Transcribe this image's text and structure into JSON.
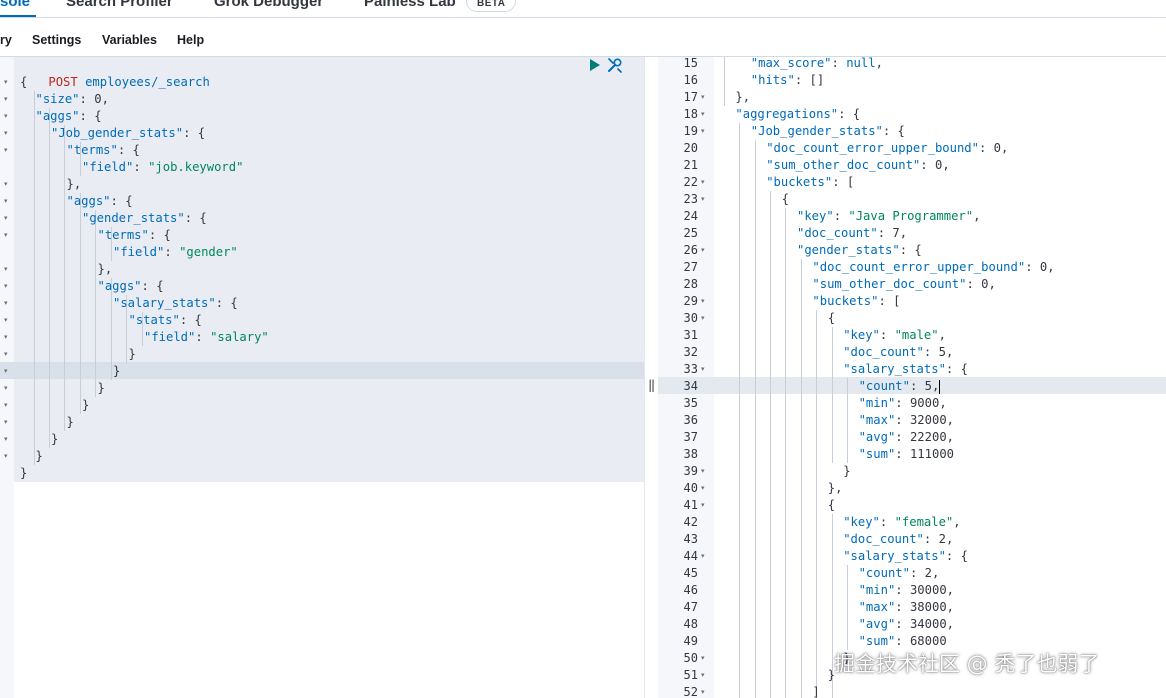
{
  "tabs": [
    {
      "label": "sole",
      "active": true
    },
    {
      "label": "Search Profiler",
      "active": false
    },
    {
      "label": "Grok Debugger",
      "active": false
    },
    {
      "label": "Painless Lab",
      "active": false
    }
  ],
  "beta_badge": "BETA",
  "menu": {
    "history": "ry",
    "settings": "Settings",
    "variables": "Variables",
    "help": "Help"
  },
  "request": {
    "method": "POST",
    "url": "employees/_search"
  },
  "response_lines": [
    {
      "num": "15",
      "fold": false
    },
    {
      "num": "16",
      "fold": false
    },
    {
      "num": "17",
      "fold": true
    },
    {
      "num": "18",
      "fold": true
    },
    {
      "num": "19",
      "fold": true
    },
    {
      "num": "20",
      "fold": false
    },
    {
      "num": "21",
      "fold": false
    },
    {
      "num": "22",
      "fold": true
    },
    {
      "num": "23",
      "fold": true
    },
    {
      "num": "24",
      "fold": false
    },
    {
      "num": "25",
      "fold": false
    },
    {
      "num": "26",
      "fold": true
    },
    {
      "num": "27",
      "fold": false
    },
    {
      "num": "28",
      "fold": false
    },
    {
      "num": "29",
      "fold": true
    },
    {
      "num": "30",
      "fold": true
    },
    {
      "num": "31",
      "fold": false
    },
    {
      "num": "32",
      "fold": false
    },
    {
      "num": "33",
      "fold": true
    },
    {
      "num": "34",
      "fold": false
    },
    {
      "num": "35",
      "fold": false
    },
    {
      "num": "36",
      "fold": false
    },
    {
      "num": "37",
      "fold": false
    },
    {
      "num": "38",
      "fold": false
    },
    {
      "num": "39",
      "fold": true
    },
    {
      "num": "40",
      "fold": true
    },
    {
      "num": "41",
      "fold": true
    },
    {
      "num": "42",
      "fold": false
    },
    {
      "num": "43",
      "fold": false
    },
    {
      "num": "44",
      "fold": true
    },
    {
      "num": "45",
      "fold": false
    },
    {
      "num": "46",
      "fold": false
    },
    {
      "num": "47",
      "fold": false
    },
    {
      "num": "48",
      "fold": false
    },
    {
      "num": "49",
      "fold": false
    },
    {
      "num": "50",
      "fold": true
    },
    {
      "num": "51",
      "fold": true
    },
    {
      "num": "52",
      "fold": true
    }
  ],
  "left_code": [
    {
      "parts": [
        [
          "p",
          "{"
        ]
      ]
    },
    {
      "parts": [
        [
          "k",
          "\"size\""
        ],
        [
          "p",
          ": "
        ],
        [
          "n",
          "0"
        ],
        [
          "p",
          ","
        ]
      ]
    },
    {
      "parts": [
        [
          "k",
          "\"aggs\""
        ],
        [
          "p",
          ": {"
        ]
      ]
    },
    {
      "parts": [
        [
          "k",
          "\"Job_gender_stats\""
        ],
        [
          "p",
          ": {"
        ]
      ]
    },
    {
      "parts": [
        [
          "k",
          "\"terms\""
        ],
        [
          "p",
          ": {"
        ]
      ]
    },
    {
      "parts": [
        [
          "k",
          "\"field\""
        ],
        [
          "p",
          ": "
        ],
        [
          "s",
          "\"job.keyword\""
        ]
      ]
    },
    {
      "parts": [
        [
          "p",
          "},"
        ]
      ]
    },
    {
      "parts": [
        [
          "k",
          "\"aggs\""
        ],
        [
          "p",
          ": {"
        ]
      ]
    },
    {
      "parts": [
        [
          "k",
          "\"gender_stats\""
        ],
        [
          "p",
          ": {"
        ]
      ]
    },
    {
      "parts": [
        [
          "k",
          "\"terms\""
        ],
        [
          "p",
          ": {"
        ]
      ]
    },
    {
      "parts": [
        [
          "k",
          "\"field\""
        ],
        [
          "p",
          ": "
        ],
        [
          "s",
          "\"gender\""
        ]
      ]
    },
    {
      "parts": [
        [
          "p",
          "},"
        ]
      ]
    },
    {
      "parts": [
        [
          "k",
          "\"aggs\""
        ],
        [
          "p",
          ": {"
        ]
      ]
    },
    {
      "parts": [
        [
          "k",
          "\"salary_stats\""
        ],
        [
          "p",
          ": {"
        ]
      ]
    },
    {
      "parts": [
        [
          "k",
          "\"stats\""
        ],
        [
          "p",
          ": {"
        ]
      ]
    },
    {
      "parts": [
        [
          "k",
          "\"field\""
        ],
        [
          "p",
          ": "
        ],
        [
          "s",
          "\"salary\""
        ]
      ]
    },
    {
      "parts": [
        [
          "p",
          "}"
        ]
      ]
    },
    {
      "parts": [
        [
          "p",
          "}"
        ]
      ]
    },
    {
      "parts": [
        [
          "p",
          "}"
        ]
      ]
    },
    {
      "parts": [
        [
          "p",
          "}"
        ]
      ]
    },
    {
      "parts": [
        [
          "p",
          "}"
        ]
      ]
    },
    {
      "parts": [
        [
          "p",
          "}"
        ]
      ]
    },
    {
      "parts": [
        [
          "p",
          "}"
        ]
      ]
    },
    {
      "parts": [
        [
          "p",
          "}"
        ]
      ]
    }
  ],
  "right_code": [
    {
      "parts": [
        [
          "k",
          "\"max_score\""
        ],
        [
          "p",
          ": "
        ],
        [
          "kw",
          "null"
        ],
        [
          "p",
          ","
        ]
      ]
    },
    {
      "parts": [
        [
          "k",
          "\"hits\""
        ],
        [
          "p",
          ": []"
        ]
      ]
    },
    {
      "parts": [
        [
          "p",
          "},"
        ]
      ]
    },
    {
      "parts": [
        [
          "k",
          "\"aggregations\""
        ],
        [
          "p",
          ": {"
        ]
      ]
    },
    {
      "parts": [
        [
          "k",
          "\"Job_gender_stats\""
        ],
        [
          "p",
          ": {"
        ]
      ]
    },
    {
      "parts": [
        [
          "k",
          "\"doc_count_error_upper_bound\""
        ],
        [
          "p",
          ": "
        ],
        [
          "n",
          "0"
        ],
        [
          "p",
          ","
        ]
      ]
    },
    {
      "parts": [
        [
          "k",
          "\"sum_other_doc_count\""
        ],
        [
          "p",
          ": "
        ],
        [
          "n",
          "0"
        ],
        [
          "p",
          ","
        ]
      ]
    },
    {
      "parts": [
        [
          "k",
          "\"buckets\""
        ],
        [
          "p",
          ": ["
        ]
      ]
    },
    {
      "parts": [
        [
          "p",
          "{"
        ]
      ]
    },
    {
      "parts": [
        [
          "k",
          "\"key\""
        ],
        [
          "p",
          ": "
        ],
        [
          "s",
          "\"Java Programmer\""
        ],
        [
          "p",
          ","
        ]
      ]
    },
    {
      "parts": [
        [
          "k",
          "\"doc_count\""
        ],
        [
          "p",
          ": "
        ],
        [
          "n",
          "7"
        ],
        [
          "p",
          ","
        ]
      ]
    },
    {
      "parts": [
        [
          "k",
          "\"gender_stats\""
        ],
        [
          "p",
          ": {"
        ]
      ]
    },
    {
      "parts": [
        [
          "k",
          "\"doc_count_error_upper_bound\""
        ],
        [
          "p",
          ": "
        ],
        [
          "n",
          "0"
        ],
        [
          "p",
          ","
        ]
      ]
    },
    {
      "parts": [
        [
          "k",
          "\"sum_other_doc_count\""
        ],
        [
          "p",
          ": "
        ],
        [
          "n",
          "0"
        ],
        [
          "p",
          ","
        ]
      ]
    },
    {
      "parts": [
        [
          "k",
          "\"buckets\""
        ],
        [
          "p",
          ": ["
        ]
      ]
    },
    {
      "parts": [
        [
          "p",
          "{"
        ]
      ]
    },
    {
      "parts": [
        [
          "k",
          "\"key\""
        ],
        [
          "p",
          ": "
        ],
        [
          "s",
          "\"male\""
        ],
        [
          "p",
          ","
        ]
      ]
    },
    {
      "parts": [
        [
          "k",
          "\"doc_count\""
        ],
        [
          "p",
          ": "
        ],
        [
          "n",
          "5"
        ],
        [
          "p",
          ","
        ]
      ]
    },
    {
      "parts": [
        [
          "k",
          "\"salary_stats\""
        ],
        [
          "p",
          ": {"
        ]
      ]
    },
    {
      "parts": [
        [
          "k",
          "\"count\""
        ],
        [
          "p",
          ": "
        ],
        [
          "n",
          "5"
        ],
        [
          "p",
          ","
        ]
      ]
    },
    {
      "parts": [
        [
          "k",
          "\"min\""
        ],
        [
          "p",
          ": "
        ],
        [
          "n",
          "9000"
        ],
        [
          "p",
          ","
        ]
      ]
    },
    {
      "parts": [
        [
          "k",
          "\"max\""
        ],
        [
          "p",
          ": "
        ],
        [
          "n",
          "32000"
        ],
        [
          "p",
          ","
        ]
      ]
    },
    {
      "parts": [
        [
          "k",
          "\"avg\""
        ],
        [
          "p",
          ": "
        ],
        [
          "n",
          "22200"
        ],
        [
          "p",
          ","
        ]
      ]
    },
    {
      "parts": [
        [
          "k",
          "\"sum\""
        ],
        [
          "p",
          ": "
        ],
        [
          "n",
          "111000"
        ]
      ]
    },
    {
      "parts": [
        [
          "p",
          "}"
        ]
      ]
    },
    {
      "parts": [
        [
          "p",
          "},"
        ]
      ]
    },
    {
      "parts": [
        [
          "p",
          "{"
        ]
      ]
    },
    {
      "parts": [
        [
          "k",
          "\"key\""
        ],
        [
          "p",
          ": "
        ],
        [
          "s",
          "\"female\""
        ],
        [
          "p",
          ","
        ]
      ]
    },
    {
      "parts": [
        [
          "k",
          "\"doc_count\""
        ],
        [
          "p",
          ": "
        ],
        [
          "n",
          "2"
        ],
        [
          "p",
          ","
        ]
      ]
    },
    {
      "parts": [
        [
          "k",
          "\"salary_stats\""
        ],
        [
          "p",
          ": {"
        ]
      ]
    },
    {
      "parts": [
        [
          "k",
          "\"count\""
        ],
        [
          "p",
          ": "
        ],
        [
          "n",
          "2"
        ],
        [
          "p",
          ","
        ]
      ]
    },
    {
      "parts": [
        [
          "k",
          "\"min\""
        ],
        [
          "p",
          ": "
        ],
        [
          "n",
          "30000"
        ],
        [
          "p",
          ","
        ]
      ]
    },
    {
      "parts": [
        [
          "k",
          "\"max\""
        ],
        [
          "p",
          ": "
        ],
        [
          "n",
          "38000"
        ],
        [
          "p",
          ","
        ]
      ]
    },
    {
      "parts": [
        [
          "k",
          "\"avg\""
        ],
        [
          "p",
          ": "
        ],
        [
          "n",
          "34000"
        ],
        [
          "p",
          ","
        ]
      ]
    },
    {
      "parts": [
        [
          "k",
          "\"sum\""
        ],
        [
          "p",
          ": "
        ],
        [
          "n",
          "68000"
        ]
      ]
    },
    {
      "parts": [
        [
          "p",
          "}"
        ]
      ]
    },
    {
      "parts": [
        [
          "p",
          "}"
        ]
      ]
    },
    {
      "parts": [
        [
          "p",
          "]"
        ]
      ]
    }
  ],
  "watermark": "掘金技术社区 @ 秃了也弱了",
  "icons": {
    "run": "play-icon",
    "options": "wrench-icon",
    "splitter": "resize-grip-icon"
  },
  "colors": {
    "accent": "#006bb8",
    "run_button": "#017d73",
    "method": "#bd271e",
    "string": "#00875a"
  }
}
